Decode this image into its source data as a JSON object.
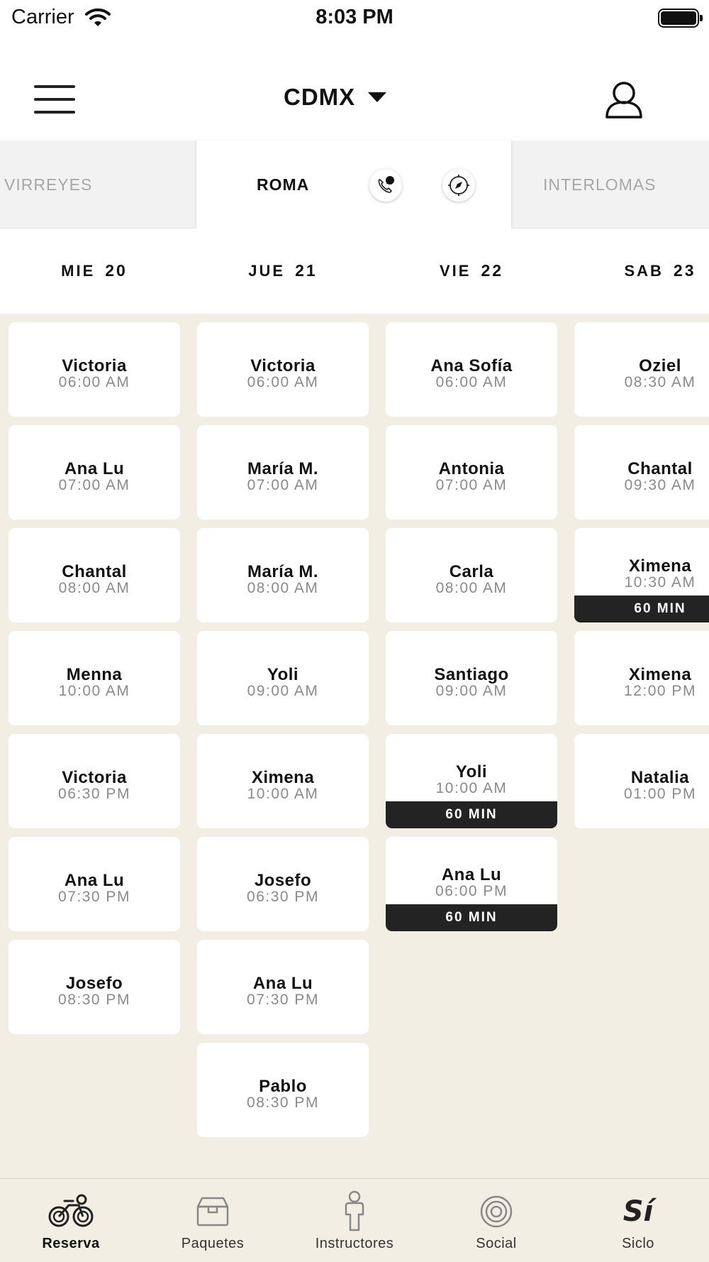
{
  "status_bar": {
    "carrier": "Carrier",
    "time": "8:03 PM"
  },
  "header": {
    "city": "CDMX"
  },
  "studios": {
    "left": "VIRREYES",
    "active": "ROMA",
    "right": "INTERLOMAS"
  },
  "days": [
    {
      "dow": "MIE",
      "num": "20"
    },
    {
      "dow": "JUE",
      "num": "21"
    },
    {
      "dow": "VIE",
      "num": "22"
    },
    {
      "dow": "SAB",
      "num": "23"
    }
  ],
  "schedule": [
    [
      {
        "name": "Victoria",
        "time": "06:00 AM"
      },
      {
        "name": "Ana Lu",
        "time": "07:00 AM"
      },
      {
        "name": "Chantal",
        "time": "08:00 AM"
      },
      {
        "name": "Menna",
        "time": "10:00 AM"
      },
      {
        "name": "Victoria",
        "time": "06:30 PM"
      },
      {
        "name": "Ana Lu",
        "time": "07:30 PM"
      },
      {
        "name": "Josefo",
        "time": "08:30 PM"
      }
    ],
    [
      {
        "name": "Victoria",
        "time": "06:00 AM"
      },
      {
        "name": "María M.",
        "time": "07:00 AM"
      },
      {
        "name": "María M.",
        "time": "08:00 AM"
      },
      {
        "name": "Yoli",
        "time": "09:00 AM"
      },
      {
        "name": "Ximena",
        "time": "10:00 AM"
      },
      {
        "name": "Josefo",
        "time": "06:30 PM"
      },
      {
        "name": "Ana Lu",
        "time": "07:30 PM"
      },
      {
        "name": "Pablo",
        "time": "08:30 PM"
      }
    ],
    [
      {
        "name": "Ana Sofía",
        "time": "06:00 AM"
      },
      {
        "name": "Antonia",
        "time": "07:00 AM"
      },
      {
        "name": "Carla",
        "time": "08:00 AM"
      },
      {
        "name": "Santiago",
        "time": "09:00 AM"
      },
      {
        "name": "Yoli",
        "time": "10:00 AM",
        "tag": "60 MIN"
      },
      {
        "name": "Ana Lu",
        "time": "06:00 PM",
        "tag": "60 MIN"
      }
    ],
    [
      {
        "name": "Oziel",
        "time": "08:30 AM"
      },
      {
        "name": "Chantal",
        "time": "09:30 AM"
      },
      {
        "name": "Ximena",
        "time": "10:30 AM",
        "tag": "60 MIN"
      },
      {
        "name": "Ximena",
        "time": "12:00 PM"
      },
      {
        "name": "Natalia",
        "time": "01:00 PM"
      }
    ]
  ],
  "nav": [
    {
      "label": "Reserva",
      "icon": "bike-icon",
      "active": true
    },
    {
      "label": "Paquetes",
      "icon": "package-icon"
    },
    {
      "label": "Instructores",
      "icon": "instructor-icon"
    },
    {
      "label": "Social",
      "icon": "social-icon"
    },
    {
      "label": "Siclo",
      "icon": "siclo-logo",
      "logo_text": "Sí"
    }
  ],
  "colors": {
    "schedule_bg": "#f2eee4",
    "tag_bg": "#232323",
    "muted_text": "#a7a7a7"
  }
}
